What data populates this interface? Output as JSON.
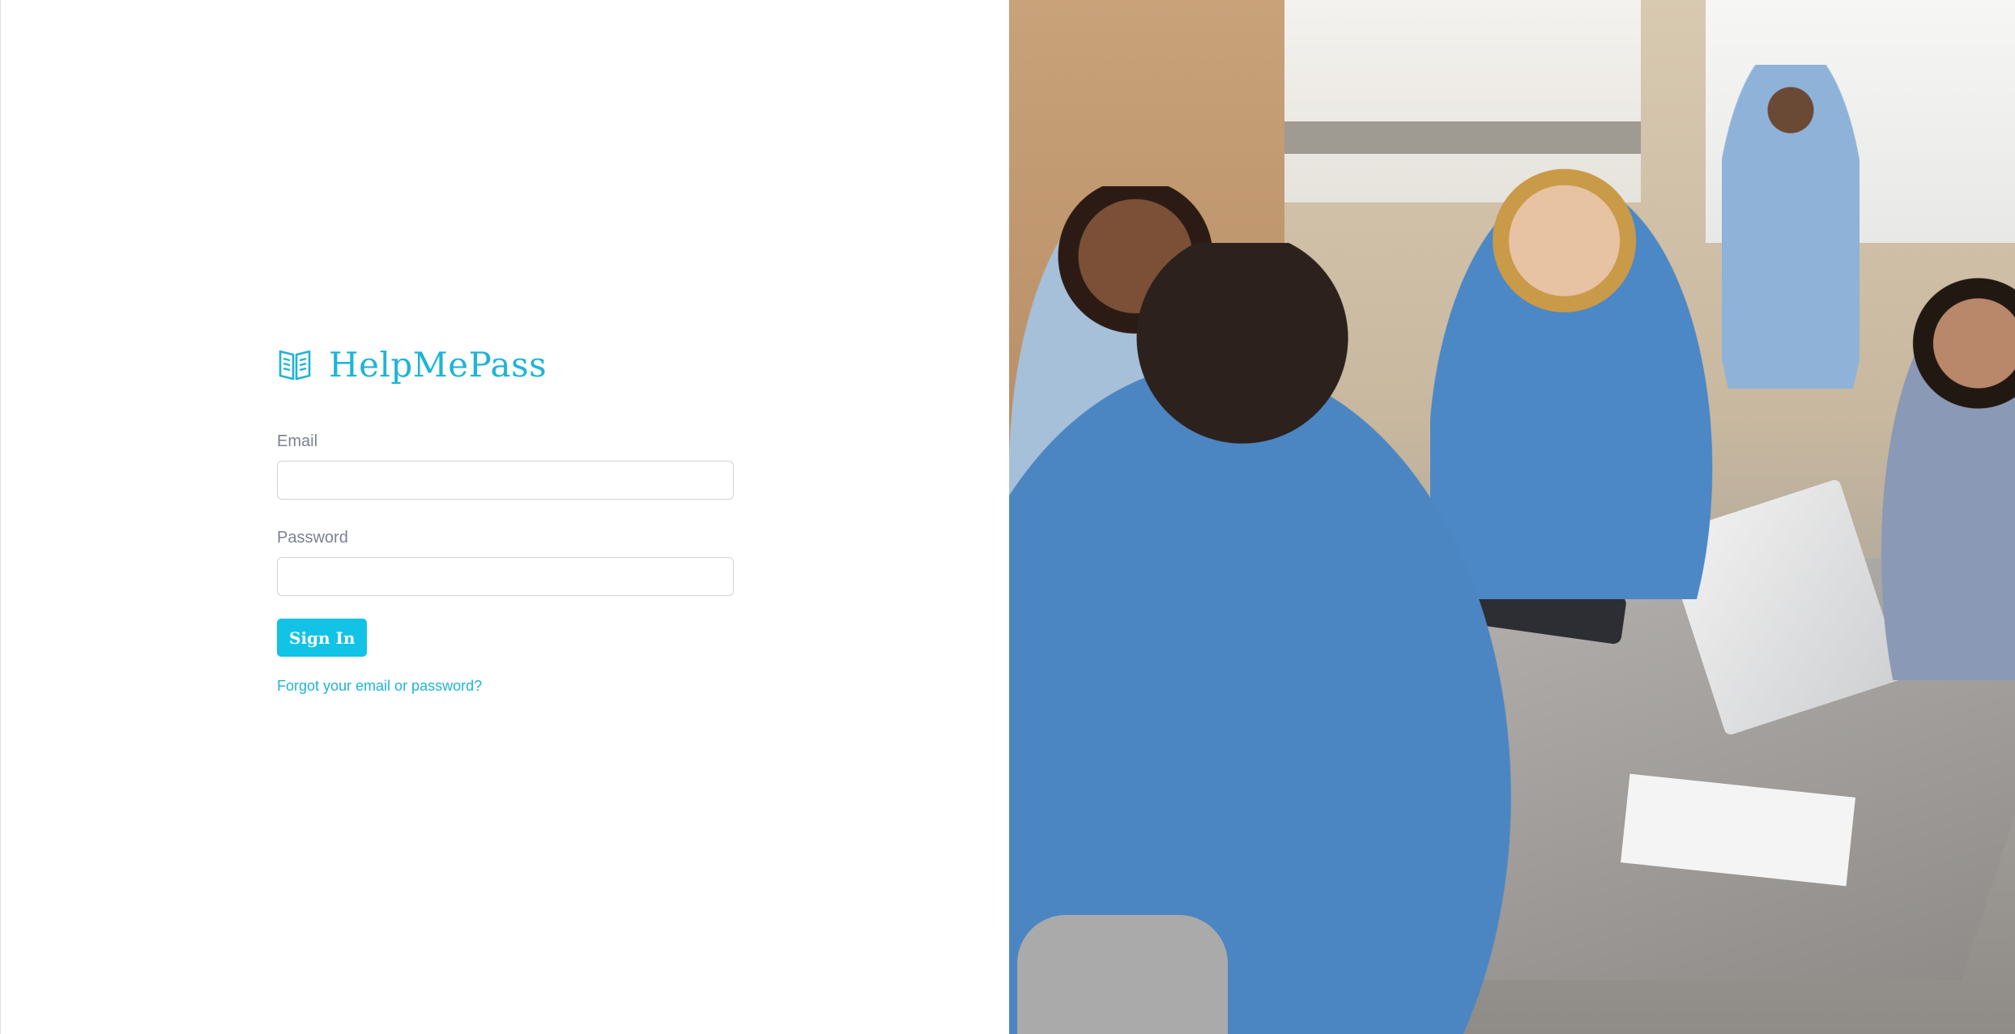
{
  "brand": {
    "name": "HelpMePass",
    "icon": "open-book-icon",
    "color": "#1fb4d5"
  },
  "form": {
    "email_label": "Email",
    "email_value": "",
    "password_label": "Password",
    "password_value": "",
    "signin_label": "Sign In",
    "forgot_label": "Forgot your email or password?"
  },
  "colors": {
    "accent": "#12c3e6",
    "link": "#1fb4d5",
    "label": "#7a8190"
  },
  "hero_image": {
    "icon": "classroom-students-photo"
  }
}
